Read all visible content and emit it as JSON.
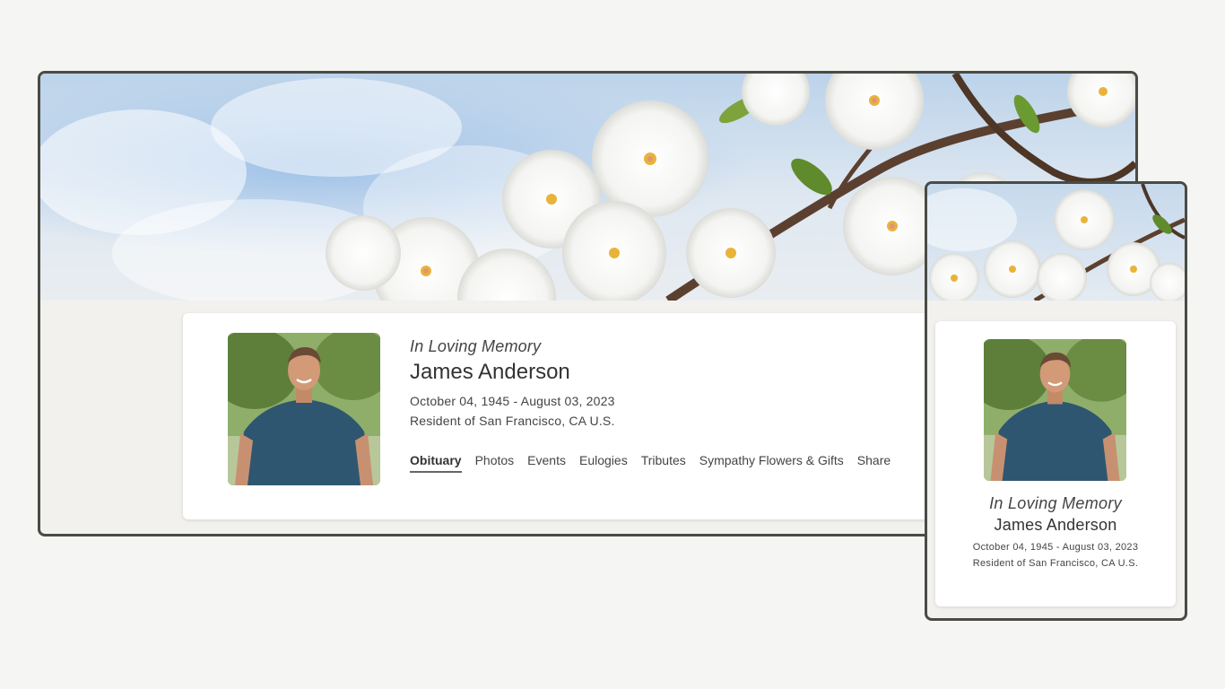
{
  "memorial": {
    "tagline": "In Loving Memory",
    "name": "James Anderson",
    "dates": "October 04, 1945 - August 03, 2023",
    "resident": "Resident of San Francisco, CA U.S."
  },
  "nav": {
    "tabs": [
      {
        "label": "Obituary",
        "active": true
      },
      {
        "label": "Photos",
        "active": false
      },
      {
        "label": "Events",
        "active": false
      },
      {
        "label": "Eulogies",
        "active": false
      },
      {
        "label": "Tributes",
        "active": false
      },
      {
        "label": "Sympathy Flowers & Gifts",
        "active": false
      },
      {
        "label": "Share",
        "active": false
      }
    ]
  },
  "colors": {
    "frame_border": "#4a4b45",
    "page_background": "#f5f5f4",
    "card_background": "#ffffff",
    "shirt": "#2f5670"
  }
}
